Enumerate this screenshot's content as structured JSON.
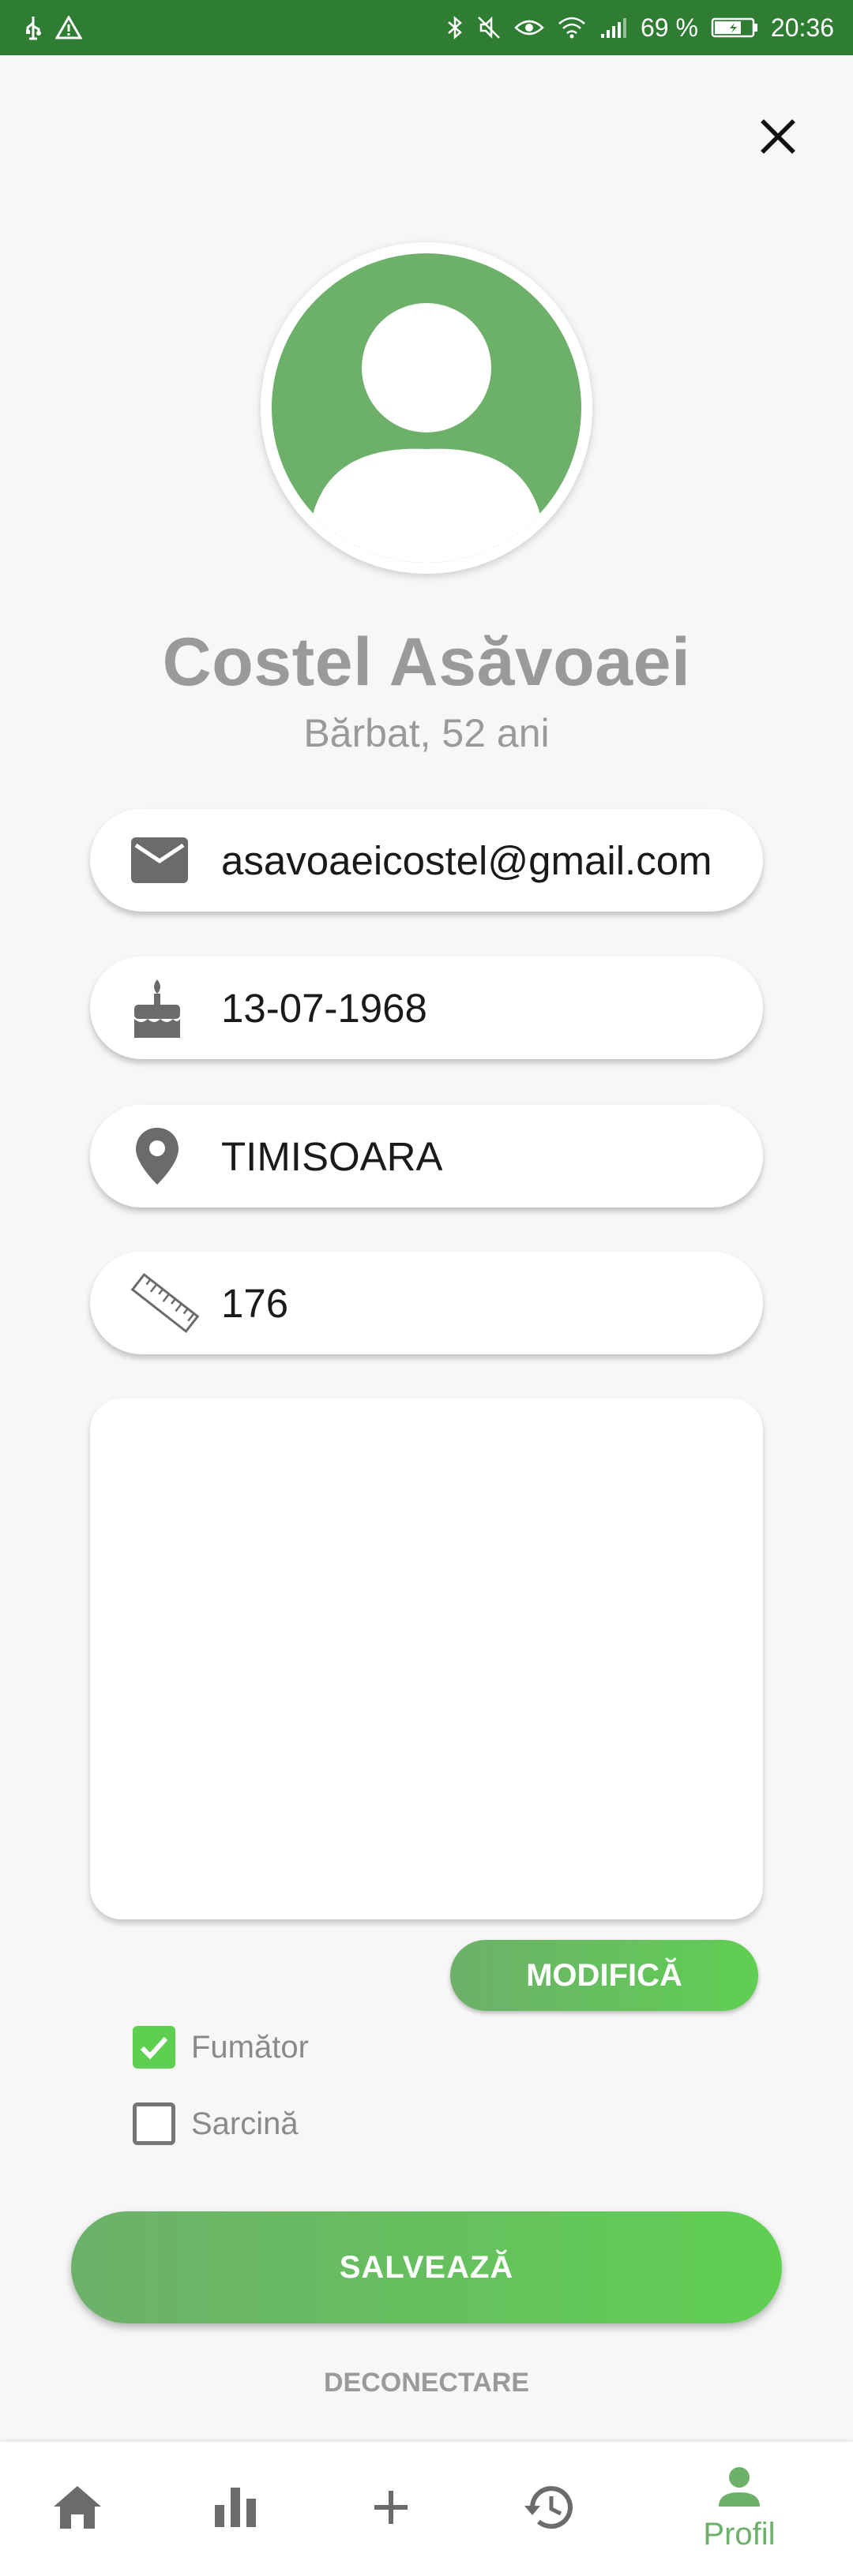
{
  "status_bar": {
    "battery": "69 %",
    "time": "20:36"
  },
  "profile": {
    "name": "Costel Asăvoaei",
    "subtitle": "Bărbat, 52 ani"
  },
  "fields": {
    "email": "asavoaeicostel@gmail.com",
    "birthdate": "13-07-1968",
    "city": "TIMISOARA",
    "height": "176"
  },
  "notes": {
    "text": ""
  },
  "buttons": {
    "modify": "MODIFICĂ",
    "save": "SALVEAZĂ",
    "logout": "DECONECTARE"
  },
  "checkboxes": [
    {
      "label": "Fumător",
      "checked": true
    },
    {
      "label": "Sarcină",
      "checked": false
    }
  ],
  "nav": {
    "items": [
      "home-icon",
      "stats-icon",
      "add-icon",
      "history-icon",
      "profile-icon"
    ],
    "active_label": "Profil"
  },
  "colors": {
    "status_bar": "#2e7d32",
    "accent": "#6db06a",
    "accent_light": "#5fcf52",
    "muted_text": "#9a9a9a"
  }
}
